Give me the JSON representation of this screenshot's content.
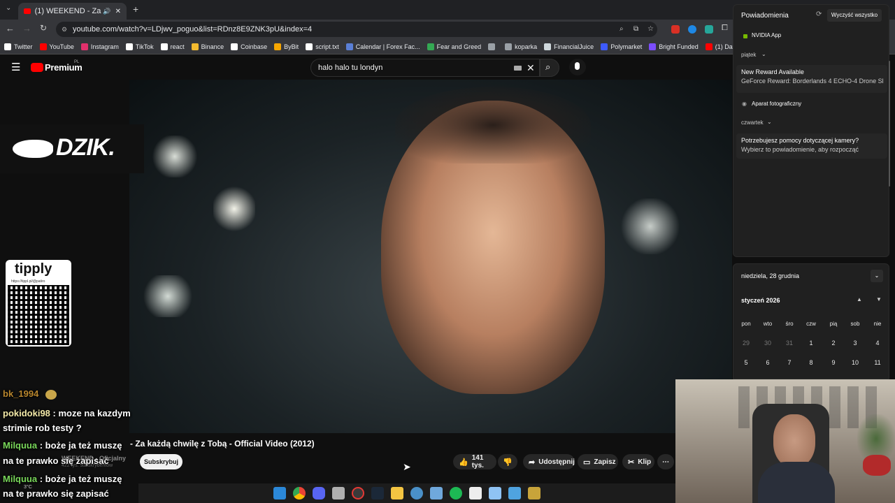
{
  "browser": {
    "tab_title": "(1) WEEKEND - Za każdą ch",
    "url": "youtube.com/watch?v=LDjwv_poguo&list=RDnz8E9ZNK3pU&index=4",
    "bookmarks": [
      {
        "label": "Twitter",
        "color": "#ffffff"
      },
      {
        "label": "YouTube",
        "color": "#ff0000"
      },
      {
        "label": "Instagram",
        "color": "#e1306c"
      },
      {
        "label": "TikTok",
        "color": "#ffffff"
      },
      {
        "label": "react",
        "color": "#ffffff"
      },
      {
        "label": "Binance",
        "color": "#f3ba2f"
      },
      {
        "label": "Coinbase",
        "color": "#ffffff"
      },
      {
        "label": "ByBit",
        "color": "#f7a600"
      },
      {
        "label": "script.txt",
        "color": "#ffffff"
      },
      {
        "label": "Calendar | Forex Fac...",
        "color": "#5a7fd6"
      },
      {
        "label": "Fear and Greed",
        "color": "#34a853"
      },
      {
        "label": "",
        "color": "#9aa0a6"
      },
      {
        "label": "koparka",
        "color": "#9aa0a6"
      },
      {
        "label": "FinancialJuice",
        "color": "#cfd8dc"
      },
      {
        "label": "Polymarket",
        "color": "#3d5afe"
      },
      {
        "label": "Bright Funded",
        "color": "#7c4dff"
      },
      {
        "label": "(1) Day Trading Boo...",
        "color": "#ff0000"
      }
    ]
  },
  "youtube": {
    "logo": "Premium",
    "logo_region": "PL",
    "search_value": "halo halo tu londyn",
    "video_title": "WEEKEND - Za każdą chwilę z Tobą - Official Video (2012)",
    "video_title_visible": "- Za każdą chwilę z Tobą - Official Video (2012)",
    "channel": "WEEKEND - Oficjalny",
    "subscribers": "422 tys. subskrybentów",
    "subscribe_label": "Subskrybuj",
    "likes": "141 tys.",
    "share_label": "Udostępnij",
    "save_label": "Zapisz",
    "clip_label": "Klip"
  },
  "overlay": {
    "dzik": "DZIK.",
    "tipply": "tipply",
    "tipply_url": "https://tippl.pl/@patiro",
    "temperature": "3°C",
    "chat": [
      {
        "user": "bk_1994",
        "user_color": "#b8862e",
        "message": ""
      },
      {
        "user": "pokidoki98",
        "user_color": "#f3e9a8",
        "message": "moze na kazdym"
      },
      {
        "user": "",
        "user_color": "#ffffff",
        "message": "strimie rob testy ?"
      },
      {
        "user": "Milquua",
        "user_color": "#79d75a",
        "message": "boże ja też muszę"
      },
      {
        "user": "",
        "user_color": "#ffffff",
        "message": "na te prawko się zapisać"
      },
      {
        "user": "Milquua",
        "user_color": "#79d75a",
        "message": "boże ja też muszę"
      },
      {
        "user": "",
        "user_color": "#ffffff",
        "message": "na te prawko się zapisać"
      }
    ]
  },
  "notifications": {
    "title": "Powiadomienia",
    "clear_all": "Wyczyść wszystko",
    "app": "NVIDIA App",
    "group1": "piątek",
    "n1_title": "New Reward Available",
    "n1_body": "GeForce Reward: Borderlands 4 ECHO-4 Drone Sl",
    "camera_app": "Aparat fotograficzny",
    "group2": "czwartek",
    "n2_title": "Potrzebujesz pomocy dotyczącej kamery?",
    "n2_body": "Wybierz to powiadomienie, aby rozpocząć"
  },
  "calendar": {
    "date_header": "niedziela, 28 grudnia",
    "month": "styczeń 2026",
    "weekdays": [
      "pon",
      "wto",
      "śro",
      "czw",
      "pią",
      "sob",
      "nie"
    ],
    "row1": [
      "29",
      "30",
      "31",
      "1",
      "2",
      "3",
      "4"
    ],
    "row2": [
      "5",
      "6",
      "7",
      "8",
      "9",
      "10",
      "11"
    ]
  }
}
